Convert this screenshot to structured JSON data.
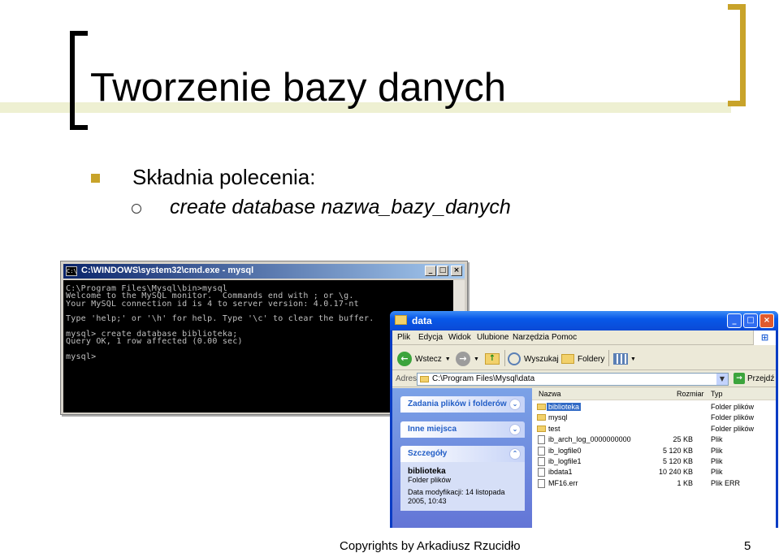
{
  "slide": {
    "title": "Tworzenie bazy danych",
    "bullet": "Składnia polecenia:",
    "sub_bullet": "create database nazwa_bazy_danych",
    "footer": "Copyrights by Arkadiusz Rzucidło",
    "page_number": "5",
    "accent_color": "#c8a32a"
  },
  "cmd": {
    "icon_text": "C:\\",
    "title": "C:\\WINDOWS\\system32\\cmd.exe - mysql",
    "lines": [
      "C:\\Program Files\\Mysql\\bin>mysql",
      "Welcome to the MySQL monitor.  Commands end with ; or \\g.",
      "Your MySQL connection id is 4 to server version: 4.0.17-nt",
      "",
      "Type 'help;' or '\\h' for help. Type '\\c' to clear the buffer.",
      "",
      "mysql> create database biblioteka;",
      "Query OK, 1 row affected (0.00 sec)",
      "",
      "mysql>"
    ]
  },
  "explorer": {
    "title": "data",
    "menu": [
      "Plik",
      "Edycja",
      "Widok",
      "Ulubione",
      "Narzędzia",
      "Pomoc"
    ],
    "toolbar": {
      "back": "Wstecz",
      "search": "Wyszukaj",
      "folders": "Foldery"
    },
    "address": {
      "label": "Adres",
      "path": "C:\\Program Files\\Mysql\\data",
      "go": "Przejdź"
    },
    "taskpane": {
      "tasks_title": "Zadania plików i folderów",
      "places_title": "Inne miejsca",
      "details_title": "Szczegóły",
      "details_name": "biblioteka",
      "details_type": "Folder plików",
      "details_modified": "Data modyfikacji: 14 listopada 2005, 10:43"
    },
    "columns": {
      "name": "Nazwa",
      "size": "Rozmiar",
      "type": "Typ"
    },
    "files": [
      {
        "name": "biblioteka",
        "size": "",
        "type": "Folder plików",
        "kind": "folder"
      },
      {
        "name": "mysql",
        "size": "",
        "type": "Folder plików",
        "kind": "folder"
      },
      {
        "name": "test",
        "size": "",
        "type": "Folder plików",
        "kind": "folder"
      },
      {
        "name": "ib_arch_log_0000000000",
        "size": "25 KB",
        "type": "Plik",
        "kind": "file"
      },
      {
        "name": "ib_logfile0",
        "size": "5 120 KB",
        "type": "Plik",
        "kind": "file"
      },
      {
        "name": "ib_logfile1",
        "size": "5 120 KB",
        "type": "Plik",
        "kind": "file"
      },
      {
        "name": "ibdata1",
        "size": "10 240 KB",
        "type": "Plik",
        "kind": "file"
      },
      {
        "name": "MF16.err",
        "size": "1 KB",
        "type": "Plik ERR",
        "kind": "file"
      }
    ]
  }
}
